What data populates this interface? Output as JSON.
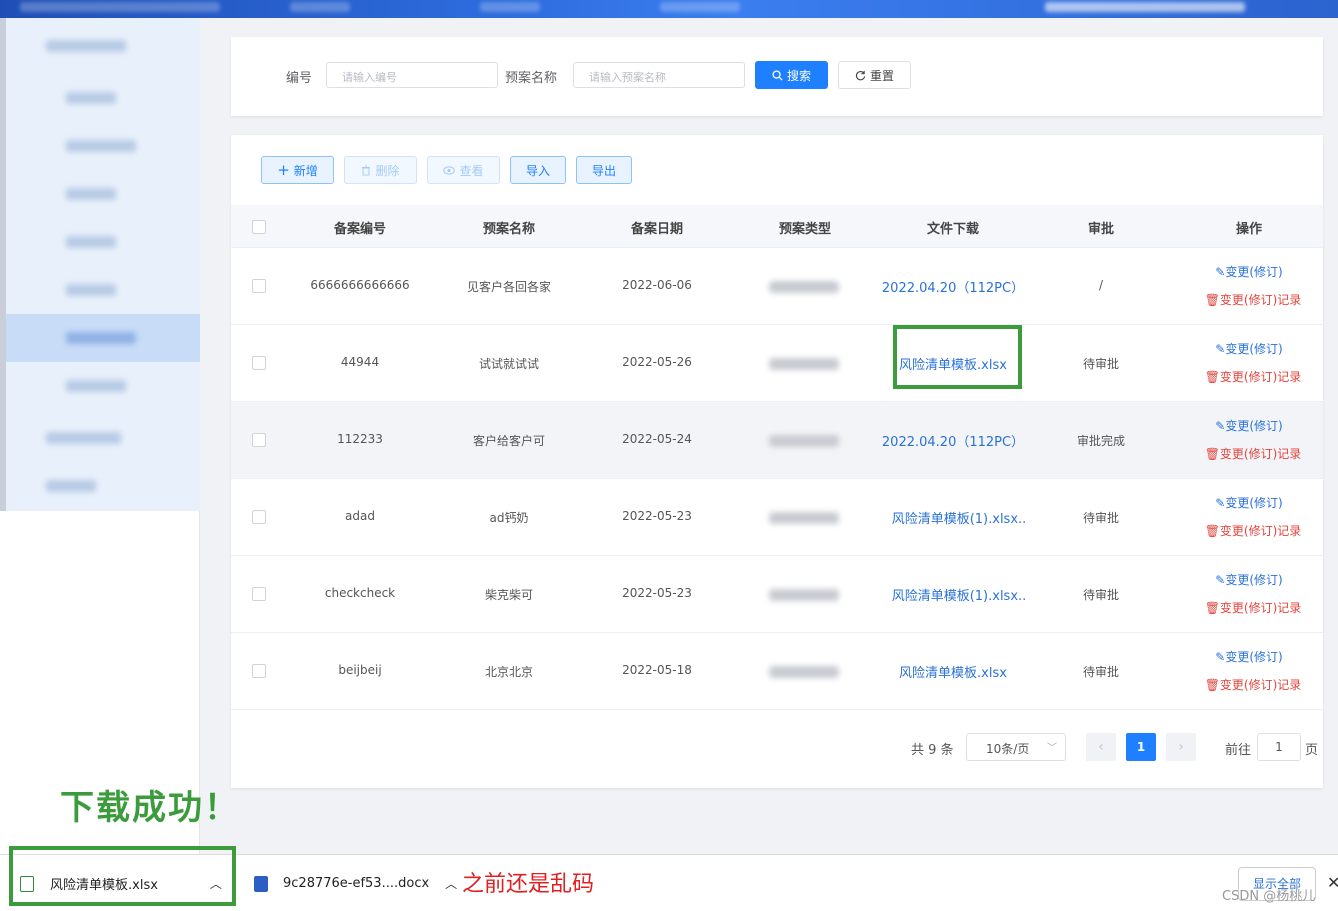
{
  "search": {
    "code_label": "编号",
    "code_placeholder": "请输入编号",
    "name_label": "预案名称",
    "name_placeholder": "请输入预案名称",
    "search_button": "搜索",
    "reset_button": "重置"
  },
  "toolbar": {
    "add": "新增",
    "delete": "删除",
    "view": "查看",
    "import": "导入",
    "export": "导出"
  },
  "table": {
    "headers": [
      "备案编号",
      "预案名称",
      "备案日期",
      "预案类型",
      "文件下载",
      "审批",
      "操作"
    ],
    "op_change": "变更(修订)",
    "op_record": "变更(修订)记录",
    "rows": [
      {
        "code": "6666666666666",
        "name": "见客户各回各家",
        "date": "2022-06-06",
        "file": "2022.04.20（112PC）",
        "approval": "/"
      },
      {
        "code": "44944",
        "name": "试试就试试",
        "date": "2022-05-26",
        "file": "风险清单模板.xlsx",
        "approval": "待审批"
      },
      {
        "code": "112233",
        "name": "客户给客户可",
        "date": "2022-05-24",
        "file": "2022.04.20（112PC）",
        "approval": "审批完成"
      },
      {
        "code": "adad",
        "name": "ad钙奶",
        "date": "2022-05-23",
        "file": "风险清单模板(1).xlsx..",
        "approval": "待审批"
      },
      {
        "code": "checkcheck",
        "name": "柴克柴可",
        "date": "2022-05-23",
        "file": "风险清单模板(1).xlsx..",
        "approval": "待审批"
      },
      {
        "code": "beijbeij",
        "name": "北京北京",
        "date": "2022-05-18",
        "file": "风险清单模板.xlsx",
        "approval": "待审批"
      }
    ]
  },
  "pagination": {
    "total": "共 9 条",
    "page_size": "10条/页",
    "current_page": "1",
    "goto_label": "前往",
    "goto_value": "1",
    "page_suffix": "页"
  },
  "annotations": {
    "success": "下载成功！",
    "garbled_note": "之前还是乱码"
  },
  "downloads": {
    "items": [
      {
        "name": "风险清单模板.xlsx",
        "icon": "excel-file-icon"
      },
      {
        "name": "9c28776e-ef53....docx",
        "icon": "word-file-icon"
      }
    ],
    "show_all": "显示全部",
    "watermark": "CSDN @杨桃儿"
  },
  "colors": {
    "primary": "#1e80ff",
    "link": "#2a72d8",
    "danger": "#e2463f",
    "highlight_green": "#3c9b3c",
    "annotation_red": "#e02020"
  }
}
